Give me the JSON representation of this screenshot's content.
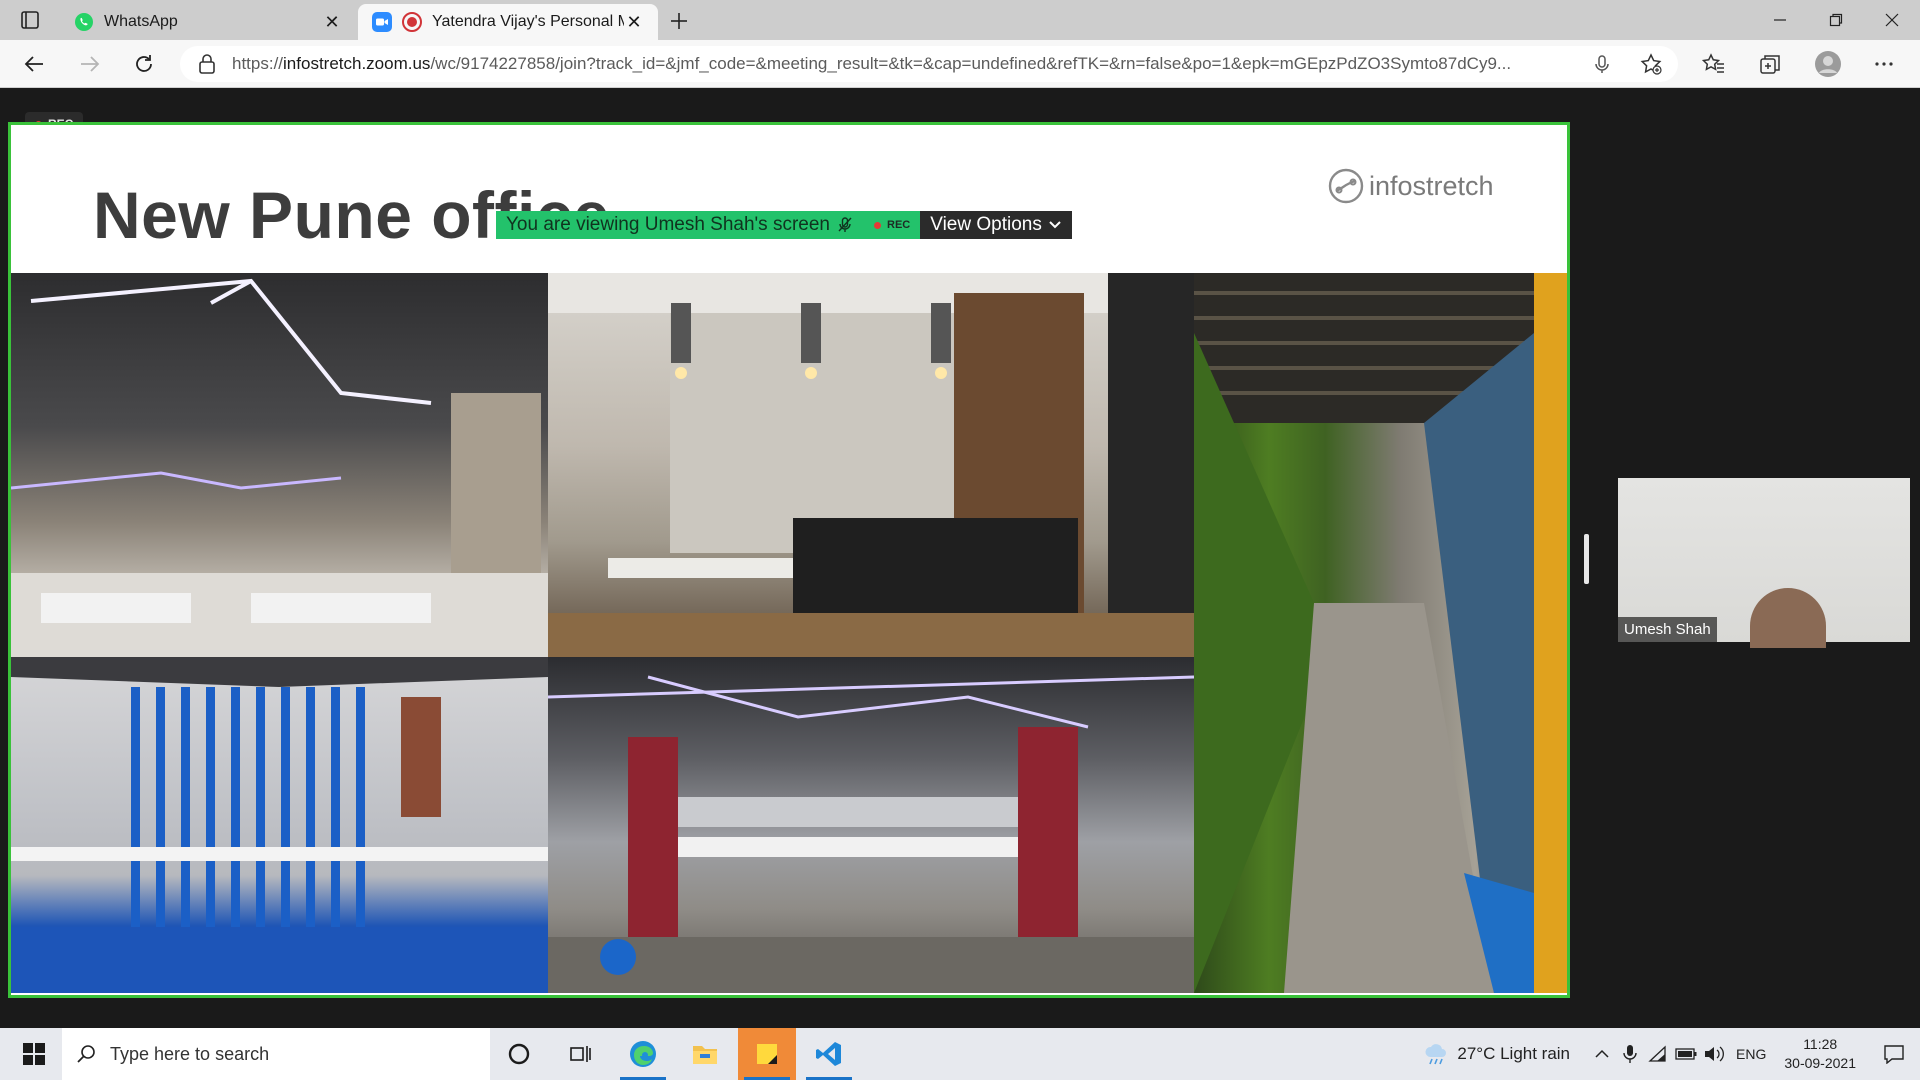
{
  "browser": {
    "tabs": [
      {
        "label": "WhatsApp",
        "icon": "whatsapp-icon",
        "active": false
      },
      {
        "label": "Yatendra Vijay's Personal Me",
        "icon": "zoom-icon",
        "active": true,
        "recording": true
      }
    ],
    "url_prefix": "https://",
    "url_domain": "infostretch.zoom.us",
    "url_rest": "/wc/9174227858/join?track_id=&jmf_code=&meeting_result=&tk=&cap=undefined&refTK=&rn=false&po=1&epk=mGEpzPdZO3Symto87dCy9..."
  },
  "meeting": {
    "rec_label": "REC",
    "banner_text": "You are viewing Umesh Shah's screen",
    "banner_rec_label": "REC",
    "view_options_label": "View Options",
    "participant_name": "Umesh Shah"
  },
  "slide": {
    "title": "New Pune office",
    "logo_text": "infostretch"
  },
  "taskbar": {
    "search_placeholder": "Type here to search",
    "weather": "27°C  Light rain",
    "language": "ENG",
    "time": "11:28",
    "date": "30-09-2021"
  },
  "colors": {
    "share_border": "#3ac23a",
    "banner_green": "#23c26b",
    "rec_red": "#e53935"
  }
}
